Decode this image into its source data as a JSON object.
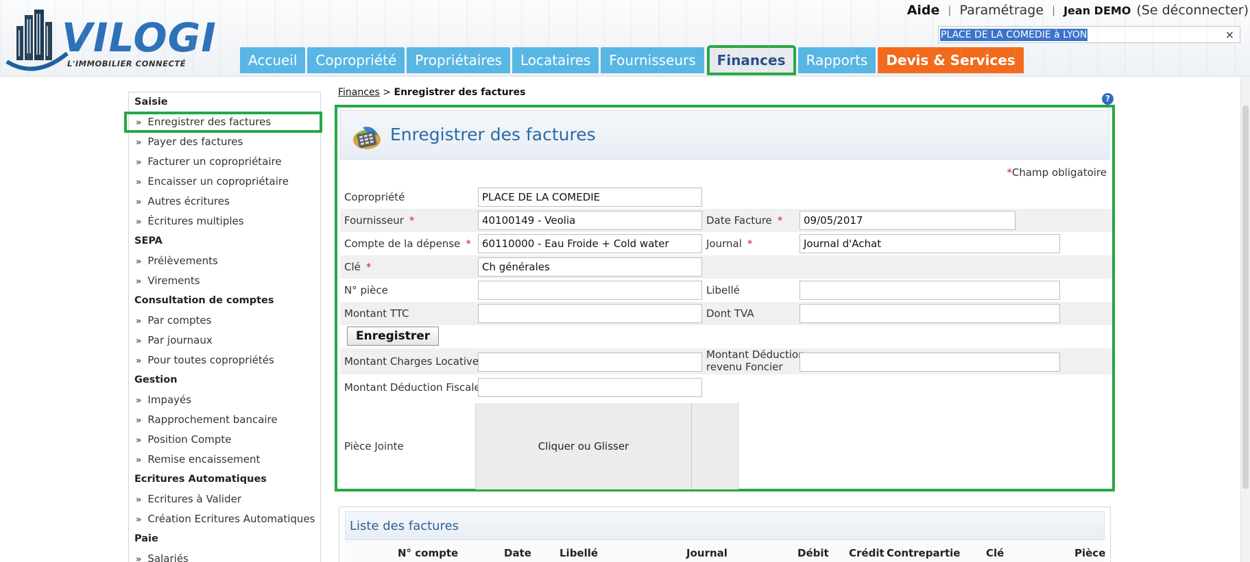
{
  "header": {
    "logo_word": "VILOGI",
    "logo_tagline": "L'IMMOBILIER CONNECTÉ",
    "links": {
      "help": "Aide",
      "settings": "Paramétrage",
      "user": "Jean DEMO",
      "logout": "(Se déconnecter)"
    },
    "search": {
      "value": "PLACE DE LA COMEDIE à LYON",
      "clear": "×"
    },
    "tabs": [
      {
        "label": "Accueil"
      },
      {
        "label": "Copropriété"
      },
      {
        "label": "Propriétaires"
      },
      {
        "label": "Locataires"
      },
      {
        "label": "Fournisseurs"
      },
      {
        "label": "Finances"
      },
      {
        "label": "Rapports"
      },
      {
        "label": "Devis & Services"
      }
    ],
    "active_tab": "Finances"
  },
  "sidebar": {
    "saisie": {
      "title": "Saisie",
      "items": [
        "Enregistrer des factures",
        "Payer des factures",
        "Facturer un copropriétaire",
        "Encaisser un copropriétaire",
        "Autres écritures",
        "Écritures multiples"
      ]
    },
    "sepa": {
      "title": "SEPA",
      "items": [
        "Prélèvements",
        "Virements"
      ]
    },
    "consultation": {
      "title": "Consultation de comptes",
      "items": [
        "Par comptes",
        "Par journaux",
        "Pour toutes copropriétés"
      ]
    },
    "gestion": {
      "title": "Gestion",
      "items": [
        "Impayés",
        "Rapprochement bancaire",
        "Position Compte",
        "Remise encaissement"
      ]
    },
    "auto": {
      "title": "Ecritures Automatiques",
      "items": [
        "Ecritures à Valider",
        "Création Ecritures Automatiques"
      ]
    },
    "paie": {
      "title": "Paie",
      "items": [
        "Salariés"
      ]
    },
    "arrow": "»"
  },
  "breadcrumb": {
    "root": "Finances",
    "sep": " > ",
    "current": "Enregistrer des factures"
  },
  "help_icon": "?",
  "form": {
    "title": "Enregistrer des factures",
    "required_note": "Champ obligatoire",
    "required_star": "*",
    "fields": {
      "copropriete": {
        "label": "Copropriété",
        "value": "PLACE DE LA COMEDIE"
      },
      "fournisseur": {
        "label": "Fournisseur",
        "value": "40100149 - Veolia"
      },
      "date_facture": {
        "label": "Date Facture",
        "value": "09/05/2017"
      },
      "compte_depense": {
        "label": "Compte de la dépense",
        "value": "60110000 - Eau Froide + Cold water"
      },
      "journal": {
        "label": "Journal",
        "value": "Journal d'Achat"
      },
      "cle": {
        "label": "Clé",
        "value": "Ch générales"
      },
      "num_piece": {
        "label": "N° pièce",
        "value": ""
      },
      "libelle": {
        "label": "Libellé",
        "value": ""
      },
      "montant_ttc": {
        "label": "Montant TTC",
        "value": ""
      },
      "dont_tva": {
        "label": "Dont TVA",
        "value": ""
      },
      "charges_locatives": {
        "label": "Montant Charges Locatives",
        "value": ""
      },
      "deduction_foncier": {
        "label_line1": "Montant Déduction",
        "label_line2": "revenu Foncier",
        "value": ""
      },
      "deduction_fiscale": {
        "label": "Montant Déduction Fiscale",
        "value": ""
      },
      "piece_jointe": {
        "label": "Pièce Jointe",
        "drop_text": "Cliquer ou Glisser"
      }
    },
    "save_button": "Enregistrer"
  },
  "invoice_list": {
    "title": "Liste des factures",
    "columns": [
      "N° compte",
      "Date",
      "Libellé",
      "Journal",
      "Débit",
      "Crédit",
      "Contrepartie",
      "Clé",
      "Pièce"
    ]
  },
  "colors": {
    "accent_green": "#27a744",
    "tab_blue": "#58b6e4",
    "tab_orange": "#f26a1b",
    "title_blue": "#2b6aa6"
  }
}
